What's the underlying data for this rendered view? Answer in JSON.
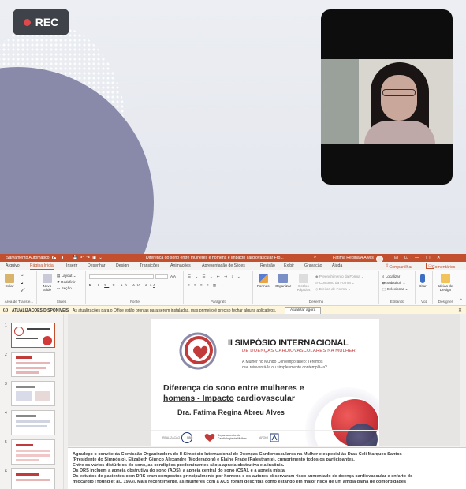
{
  "recording": {
    "label": "REC",
    "indicator_color": "#e0494a"
  },
  "ppt": {
    "titlebar": {
      "autosave": "Salvamento Automático",
      "document_title": "Diferença do sono entre mulheres e homens e impacto cardiovascular Fro...",
      "user_name": "Fatima Regina A Alves"
    },
    "tabs": [
      "Arquivo",
      "Página Inicial",
      "Inserir",
      "Desenhar",
      "Design",
      "Transições",
      "Animações",
      "Apresentação de Slides",
      "Revisão",
      "Exibir",
      "Gravação",
      "Ajuda"
    ],
    "share": "Compartilhar",
    "comments": "Comentários",
    "ribbon": {
      "paste": "Colar",
      "new_slide": "Novo Slide",
      "layout": "Layout",
      "reset": "Redefinir",
      "section": "Seção",
      "shapes": "Formas",
      "arrange": "Organizar",
      "quick_styles": "Estilos Rápidos",
      "shape_fill": "Preenchimento da Forma",
      "shape_outline": "Contorno da Forma",
      "shape_effects": "Efeitos de Forma",
      "find": "Localizar",
      "replace": "Substituir",
      "select": "Selecionar",
      "dictate": "Ditar",
      "designer": "Ideias de Design",
      "groups": {
        "clipboard": "Área de Transfe...",
        "slides": "Slides",
        "font": "Fonte",
        "paragraph": "Parágrafo",
        "drawing": "Desenho",
        "editing": "Editando",
        "voice": "Voz",
        "designer": "Designer"
      }
    },
    "infobar": {
      "title": "ATUALIZAÇÕES DISPONÍVEIS",
      "message": "As atualizações para o Office estão prontas para serem instaladas, mas primeiro é preciso fechar alguns aplicativos.",
      "button": "Atualizar agora"
    },
    "thumbnail_numbers": [
      "1",
      "2",
      "3",
      "4",
      "5",
      "6"
    ],
    "slide": {
      "title": "II SIMPÓSIO INTERNACIONAL",
      "subtitle": "DE DOENÇAS CARDIOVASCULARES NA MULHER",
      "tagline": "A Mulher no Mundo Contemporâneo: Teremos que reinventá-la ou simplesmente contemplá-la?",
      "talk_title_line1": "Diferença do sono entre mulheres e",
      "talk_title_line2_underlined": "homens - Impacto",
      "talk_title_line2_rest": " cardiovascular",
      "speaker": "Dra. Fatima Regina Abreu Alves",
      "footer_realization": "REALIZAÇÃO",
      "footer_sbc": "SBC",
      "footer_dept": "Departamento de Cardiologia da Mulher",
      "footer_support": "APOIO"
    },
    "notes": [
      "Agradeço o convite da Comissão Organizadora do II Simpósio Internacional de Doenças Cardiovasculares na Mulher e especial às Dras  Celi Marques Santos",
      "(Presidente do Simpósio). Elizabeth Gjunco Alexandre (Moderadora)  e Elaine Frade (Palestrante), cumprimento todos os participantes.",
      "Entre os vários distúrbios do sono, as condições predominantes são a apneia obstrutiva e a insônia.",
      "Os DRS incluem a apneia obstrutiva do sono (AOS), a apneia central do sono (CSA), e a apneia mista.",
      "Os estudos de pacientes com DRS eram compostos principalmente por homens e os autores observaram risco aumentado de doença cardiovascular e enfarto do",
      "miocárdio (Young et al., 1993). Mais recentemente, as mulheres com a AOS foram descritas como estando em maior risco de um ampla gama de comorbidades"
    ]
  },
  "colors": {
    "accent": "#c2502f",
    "slide_red": "#c23b3b",
    "circle": "#898aaa"
  }
}
